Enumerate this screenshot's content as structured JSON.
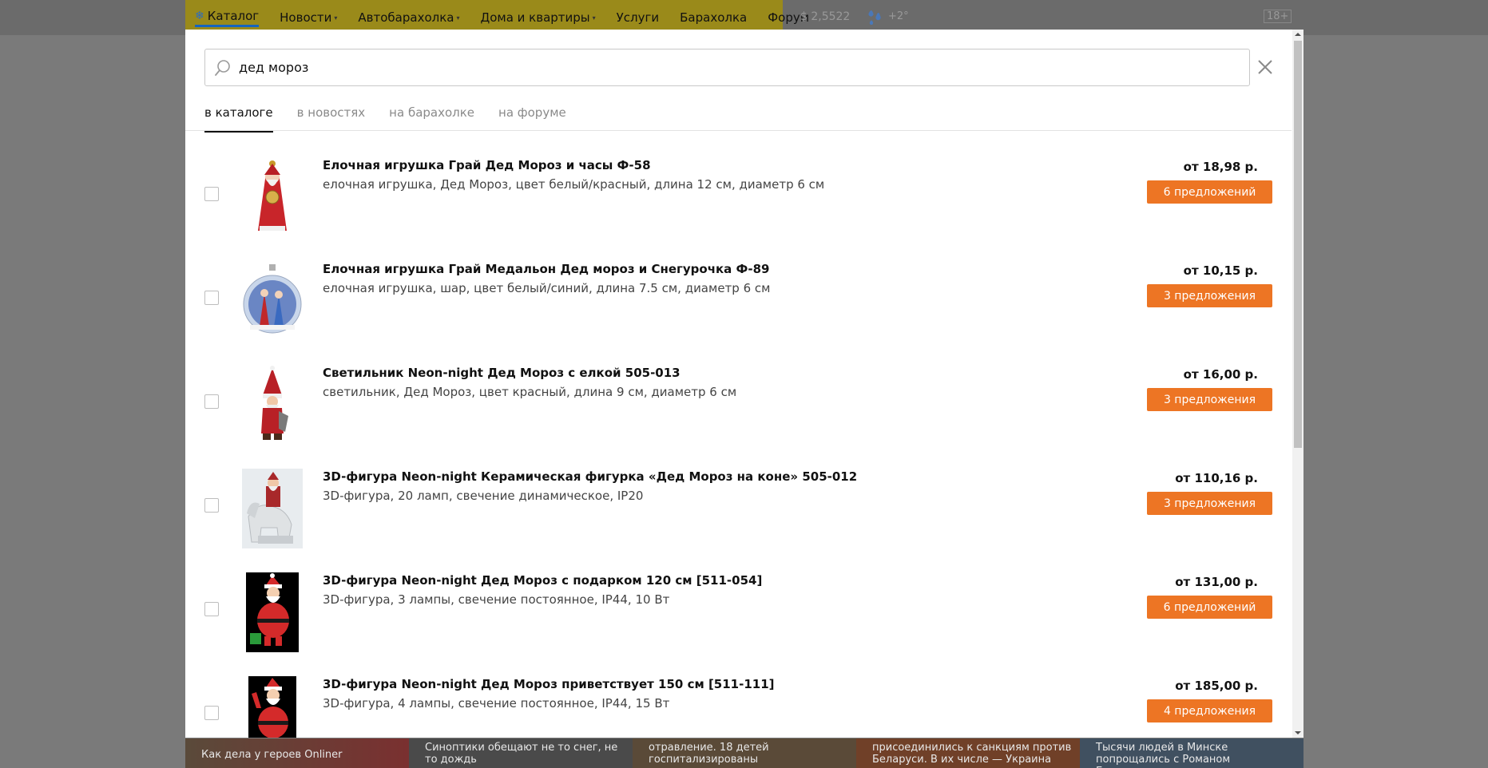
{
  "header": {
    "nav": [
      {
        "label": "Каталог",
        "active": true,
        "dropdown": false
      },
      {
        "label": "Новости",
        "active": false,
        "dropdown": true
      },
      {
        "label": "Автобарахолка",
        "active": false,
        "dropdown": true
      },
      {
        "label": "Дома и квартиры",
        "active": false,
        "dropdown": true
      },
      {
        "label": "Услуги",
        "active": false,
        "dropdown": false
      },
      {
        "label": "Барахолка",
        "active": false,
        "dropdown": false
      },
      {
        "label": "Форум",
        "active": false,
        "dropdown": false
      }
    ],
    "rate": "$ 2,5522",
    "temperature": "+2°",
    "age_badge": "18+",
    "weather_icon": "rain-icon"
  },
  "search": {
    "value": "дед мороз",
    "icon": "search-icon",
    "close_icon": "close-icon"
  },
  "tabs": [
    {
      "label": "в каталоге",
      "active": true
    },
    {
      "label": "в новостях",
      "active": false
    },
    {
      "label": "на барахолке",
      "active": false
    },
    {
      "label": "на форуме",
      "active": false
    }
  ],
  "results": [
    {
      "title": "Елочная игрушка Грай Дед Мороз и часы Ф-58",
      "desc": "елочная игрушка, Дед Мороз, цвет белый/красный, длина 12 см, диаметр 6 см",
      "price": "от 18,98 р.",
      "offers": "6 предложений"
    },
    {
      "title": "Елочная игрушка Грай Медальон Дед мороз и Снегурочка Ф-89",
      "desc": "елочная игрушка, шар, цвет белый/синий, длина 7.5 см, диаметр 6 см",
      "price": "от 10,15 р.",
      "offers": "3 предложения"
    },
    {
      "title": "Светильник Neon-night Дед Мороз с елкой 505-013",
      "desc": "светильник, Дед Мороз, цвет красный, длина 9 см, диаметр 6 см",
      "price": "от 16,00 р.",
      "offers": "3 предложения"
    },
    {
      "title": "3D-фигура Neon-night Керамическая фигурка «Дед Мороз на коне» 505-012",
      "desc": "3D-фигура, 20 ламп, свечение динамическое, IP20",
      "price": "от 110,16 р.",
      "offers": "3 предложения"
    },
    {
      "title": "3D-фигура Neon-night Дед Мороз с подарком 120 см [511-054]",
      "desc": "3D-фигура, 3 лампы, свечение постоянное, IP44, 10 Вт",
      "price": "от 131,00 р.",
      "offers": "6 предложений"
    },
    {
      "title": "3D-фигура Neon-night Дед Мороз приветствует 150 см [511-111]",
      "desc": "3D-фигура, 4 лампы, свечение постоянное, IP44, 15 Вт",
      "price": "от 185,00 р.",
      "offers": "4 предложения"
    }
  ],
  "news": [
    "Как дела у героев Onliner",
    "Синоптики обещают не то снег, не то дождь",
    "отравление. 18 детей госпитализированы",
    "присоединились к санкциям против Беларуси. В их числе — Украина",
    "Тысячи людей в Минске попрощались с Романом Бондаренко"
  ],
  "colors": {
    "accent": "#ed7524",
    "nav_bg": "#9a8a1a",
    "overlay": "#7a7a7a"
  }
}
